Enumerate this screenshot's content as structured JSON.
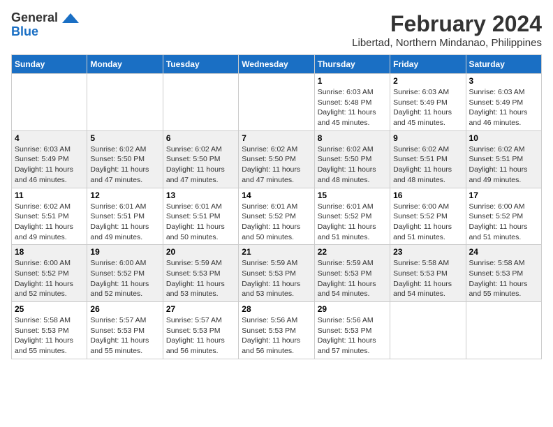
{
  "header": {
    "logo_general": "General",
    "logo_blue": "Blue",
    "month_year": "February 2024",
    "location": "Libertad, Northern Mindanao, Philippines"
  },
  "days_of_week": [
    "Sunday",
    "Monday",
    "Tuesday",
    "Wednesday",
    "Thursday",
    "Friday",
    "Saturday"
  ],
  "weeks": [
    [
      {
        "day": "",
        "info": ""
      },
      {
        "day": "",
        "info": ""
      },
      {
        "day": "",
        "info": ""
      },
      {
        "day": "",
        "info": ""
      },
      {
        "day": "1",
        "sunrise": "6:03 AM",
        "sunset": "5:48 PM",
        "daylight": "11 hours and 45 minutes."
      },
      {
        "day": "2",
        "sunrise": "6:03 AM",
        "sunset": "5:49 PM",
        "daylight": "11 hours and 45 minutes."
      },
      {
        "day": "3",
        "sunrise": "6:03 AM",
        "sunset": "5:49 PM",
        "daylight": "11 hours and 46 minutes."
      }
    ],
    [
      {
        "day": "4",
        "sunrise": "6:03 AM",
        "sunset": "5:49 PM",
        "daylight": "11 hours and 46 minutes."
      },
      {
        "day": "5",
        "sunrise": "6:02 AM",
        "sunset": "5:50 PM",
        "daylight": "11 hours and 47 minutes."
      },
      {
        "day": "6",
        "sunrise": "6:02 AM",
        "sunset": "5:50 PM",
        "daylight": "11 hours and 47 minutes."
      },
      {
        "day": "7",
        "sunrise": "6:02 AM",
        "sunset": "5:50 PM",
        "daylight": "11 hours and 47 minutes."
      },
      {
        "day": "8",
        "sunrise": "6:02 AM",
        "sunset": "5:50 PM",
        "daylight": "11 hours and 48 minutes."
      },
      {
        "day": "9",
        "sunrise": "6:02 AM",
        "sunset": "5:51 PM",
        "daylight": "11 hours and 48 minutes."
      },
      {
        "day": "10",
        "sunrise": "6:02 AM",
        "sunset": "5:51 PM",
        "daylight": "11 hours and 49 minutes."
      }
    ],
    [
      {
        "day": "11",
        "sunrise": "6:02 AM",
        "sunset": "5:51 PM",
        "daylight": "11 hours and 49 minutes."
      },
      {
        "day": "12",
        "sunrise": "6:01 AM",
        "sunset": "5:51 PM",
        "daylight": "11 hours and 49 minutes."
      },
      {
        "day": "13",
        "sunrise": "6:01 AM",
        "sunset": "5:51 PM",
        "daylight": "11 hours and 50 minutes."
      },
      {
        "day": "14",
        "sunrise": "6:01 AM",
        "sunset": "5:52 PM",
        "daylight": "11 hours and 50 minutes."
      },
      {
        "day": "15",
        "sunrise": "6:01 AM",
        "sunset": "5:52 PM",
        "daylight": "11 hours and 51 minutes."
      },
      {
        "day": "16",
        "sunrise": "6:00 AM",
        "sunset": "5:52 PM",
        "daylight": "11 hours and 51 minutes."
      },
      {
        "day": "17",
        "sunrise": "6:00 AM",
        "sunset": "5:52 PM",
        "daylight": "11 hours and 51 minutes."
      }
    ],
    [
      {
        "day": "18",
        "sunrise": "6:00 AM",
        "sunset": "5:52 PM",
        "daylight": "11 hours and 52 minutes."
      },
      {
        "day": "19",
        "sunrise": "6:00 AM",
        "sunset": "5:52 PM",
        "daylight": "11 hours and 52 minutes."
      },
      {
        "day": "20",
        "sunrise": "5:59 AM",
        "sunset": "5:53 PM",
        "daylight": "11 hours and 53 minutes."
      },
      {
        "day": "21",
        "sunrise": "5:59 AM",
        "sunset": "5:53 PM",
        "daylight": "11 hours and 53 minutes."
      },
      {
        "day": "22",
        "sunrise": "5:59 AM",
        "sunset": "5:53 PM",
        "daylight": "11 hours and 54 minutes."
      },
      {
        "day": "23",
        "sunrise": "5:58 AM",
        "sunset": "5:53 PM",
        "daylight": "11 hours and 54 minutes."
      },
      {
        "day": "24",
        "sunrise": "5:58 AM",
        "sunset": "5:53 PM",
        "daylight": "11 hours and 55 minutes."
      }
    ],
    [
      {
        "day": "25",
        "sunrise": "5:58 AM",
        "sunset": "5:53 PM",
        "daylight": "11 hours and 55 minutes."
      },
      {
        "day": "26",
        "sunrise": "5:57 AM",
        "sunset": "5:53 PM",
        "daylight": "11 hours and 55 minutes."
      },
      {
        "day": "27",
        "sunrise": "5:57 AM",
        "sunset": "5:53 PM",
        "daylight": "11 hours and 56 minutes."
      },
      {
        "day": "28",
        "sunrise": "5:56 AM",
        "sunset": "5:53 PM",
        "daylight": "11 hours and 56 minutes."
      },
      {
        "day": "29",
        "sunrise": "5:56 AM",
        "sunset": "5:53 PM",
        "daylight": "11 hours and 57 minutes."
      },
      {
        "day": "",
        "info": ""
      },
      {
        "day": "",
        "info": ""
      }
    ]
  ],
  "labels": {
    "sunrise_prefix": "Sunrise: ",
    "sunset_prefix": "Sunset: ",
    "daylight_prefix": "Daylight: "
  }
}
